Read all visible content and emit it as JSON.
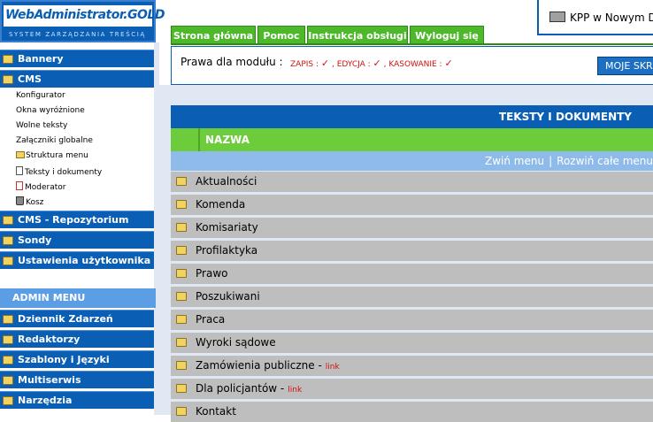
{
  "logo": {
    "title": "WebAdministrator.GOLD",
    "subtitle": "SYSTEM ZARZĄDZANIA TREŚCIĄ"
  },
  "top_nav": [
    {
      "label": "Strona główna"
    },
    {
      "label": "Pomoc"
    },
    {
      "label": "Instrukcja obsługi"
    },
    {
      "label": "Wyloguj się"
    }
  ],
  "kpp": {
    "label": "KPP w Nowym D"
  },
  "rights": {
    "label": "Prawa dla modułu :",
    "zapis": "ZAPIS :",
    "edycja": ", EDYCJA :",
    "kasowanie": ", KASOWANIE :",
    "check": "✓"
  },
  "moje_button": "MOJE SKR",
  "sidebar": {
    "cats_top": [
      "Bannery",
      "CMS"
    ],
    "cms_items": [
      "Konfigurator",
      "Okna wyróżnione",
      "Wolne teksty",
      "Załączniki globalne",
      "Struktura menu",
      "Teksty i dokumenty",
      "Moderator",
      "Kosz"
    ],
    "cats_mid": [
      "CMS - Repozytorium",
      "Sondy",
      "Ustawienia użytkownika"
    ],
    "admin_header": "ADMIN MENU",
    "admin_cats": [
      "Dziennik Zdarzeń",
      "Redaktorzy",
      "Szablony i Języki",
      "Multiserwis",
      "Narzędzia"
    ]
  },
  "content": {
    "section_title": "TEKSTY I DOKUMENTY",
    "column_header": "NAZWA",
    "collapse": "Zwiń menu",
    "separator": "|",
    "expand": "Rozwiń całe menu",
    "link_text": "link",
    "rows": [
      {
        "name": "Aktualności",
        "link": false
      },
      {
        "name": "Komenda",
        "link": false
      },
      {
        "name": "Komisariaty",
        "link": false
      },
      {
        "name": "Profilaktyka",
        "link": false
      },
      {
        "name": "Prawo",
        "link": false
      },
      {
        "name": "Poszukiwani",
        "link": false
      },
      {
        "name": "Praca",
        "link": false
      },
      {
        "name": "Wyroki sądowe",
        "link": false
      },
      {
        "name": "Zamówienia publiczne -",
        "link": true
      },
      {
        "name": "Dla policjantów -",
        "link": true
      },
      {
        "name": "Kontakt",
        "link": false
      }
    ]
  },
  "colors": {
    "brand_blue": "#0a5fb4",
    "nav_green": "#4db82a",
    "header_green": "#6ccc3c",
    "row_gray": "#bebebe",
    "red": "#d01010"
  }
}
